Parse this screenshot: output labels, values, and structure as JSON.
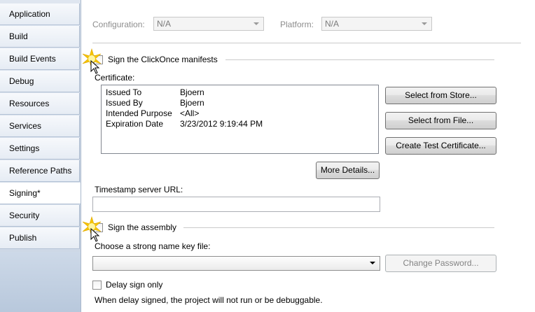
{
  "tabs": [
    "Application",
    "Build",
    "Build Events",
    "Debug",
    "Resources",
    "Services",
    "Settings",
    "Reference Paths",
    "Signing*",
    "Security",
    "Publish"
  ],
  "active_tab": "Signing*",
  "config": {
    "configuration_label": "Configuration:",
    "configuration_value": "N/A",
    "platform_label": "Platform:",
    "platform_value": "N/A"
  },
  "sign_manifests": {
    "label": "Sign the ClickOnce manifests",
    "certificate_label": "Certificate:",
    "certificate": [
      {
        "key": "Issued To",
        "value": "Bjoern"
      },
      {
        "key": "Issued By",
        "value": "Bjoern"
      },
      {
        "key": "Intended Purpose",
        "value": "<All>"
      },
      {
        "key": "Expiration Date",
        "value": "3/23/2012 9:19:44 PM"
      }
    ],
    "select_store": "Select from Store...",
    "select_file": "Select from File...",
    "create_test": "Create Test Certificate...",
    "more_details": "More Details...",
    "timestamp_label": "Timestamp server URL:",
    "timestamp_value": ""
  },
  "sign_assembly": {
    "label": "Sign the assembly",
    "key_file_label": "Choose a strong name key file:",
    "key_file_value": "",
    "change_password": "Change Password...",
    "delay_sign": "Delay sign only",
    "delay_note": "When delay signed, the project will not run or be debuggable."
  },
  "colors": {
    "accent_shield": "#f5c400",
    "tab_bg": "#dfe6f0"
  },
  "icons": [
    "uac-shield-icon",
    "cursor-icon",
    "dropdown-arrow-icon"
  ]
}
